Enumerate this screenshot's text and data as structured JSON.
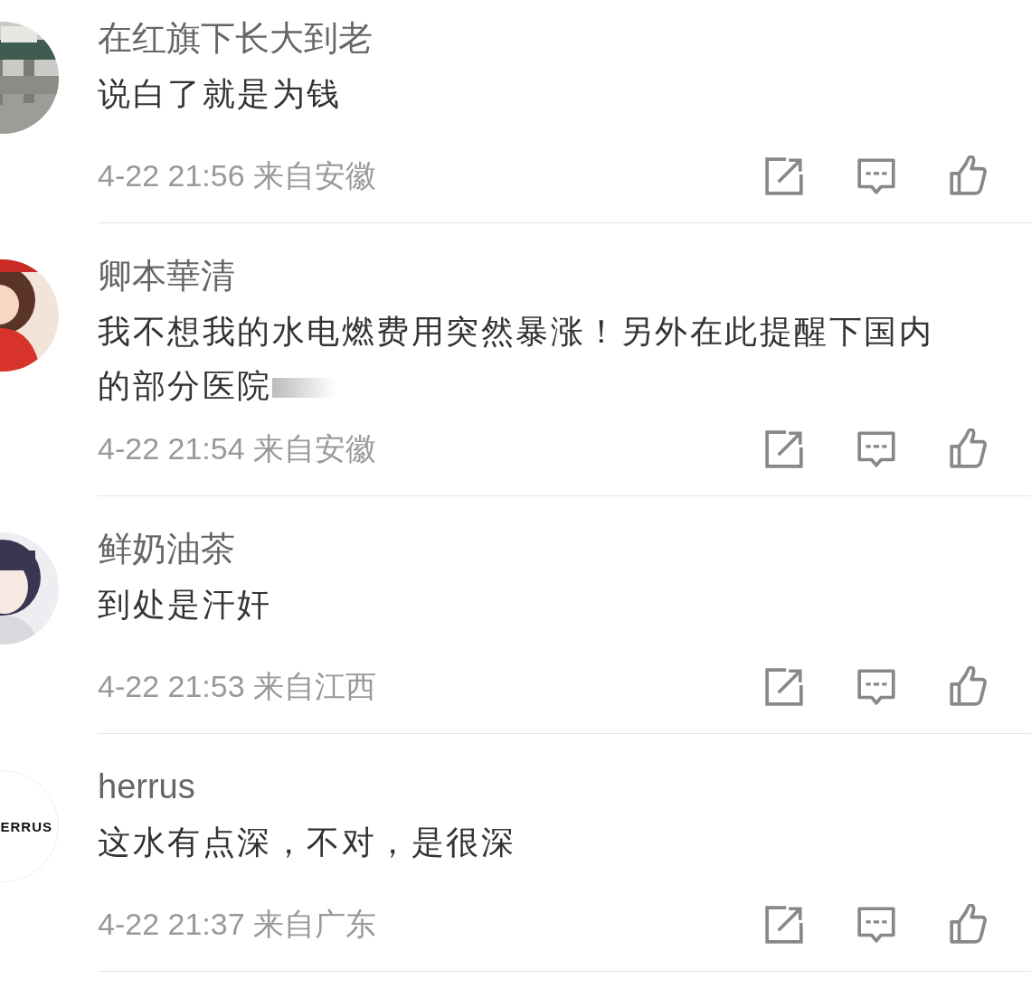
{
  "comments": [
    {
      "username": "在红旗下长大到老",
      "content": "说白了就是为钱",
      "fade": false,
      "time": "4-22 21:56 来自安徽"
    },
    {
      "username": "卿本華清",
      "content": "我不想我的水电燃费用突然暴涨！另外在此提醒下国内的部分医院",
      "fade": true,
      "time": "4-22 21:54 来自安徽"
    },
    {
      "username": "鲜奶油茶",
      "content": "到处是汗奸",
      "fade": false,
      "time": "4-22 21:53 来自江西"
    },
    {
      "avatar": {
        "kind": "logo",
        "text": "ERRUS"
      },
      "username": "herrus",
      "content": "这水有点深，不对，是很深",
      "fade": false,
      "time": "4-22 21:37 来自广东"
    }
  ]
}
